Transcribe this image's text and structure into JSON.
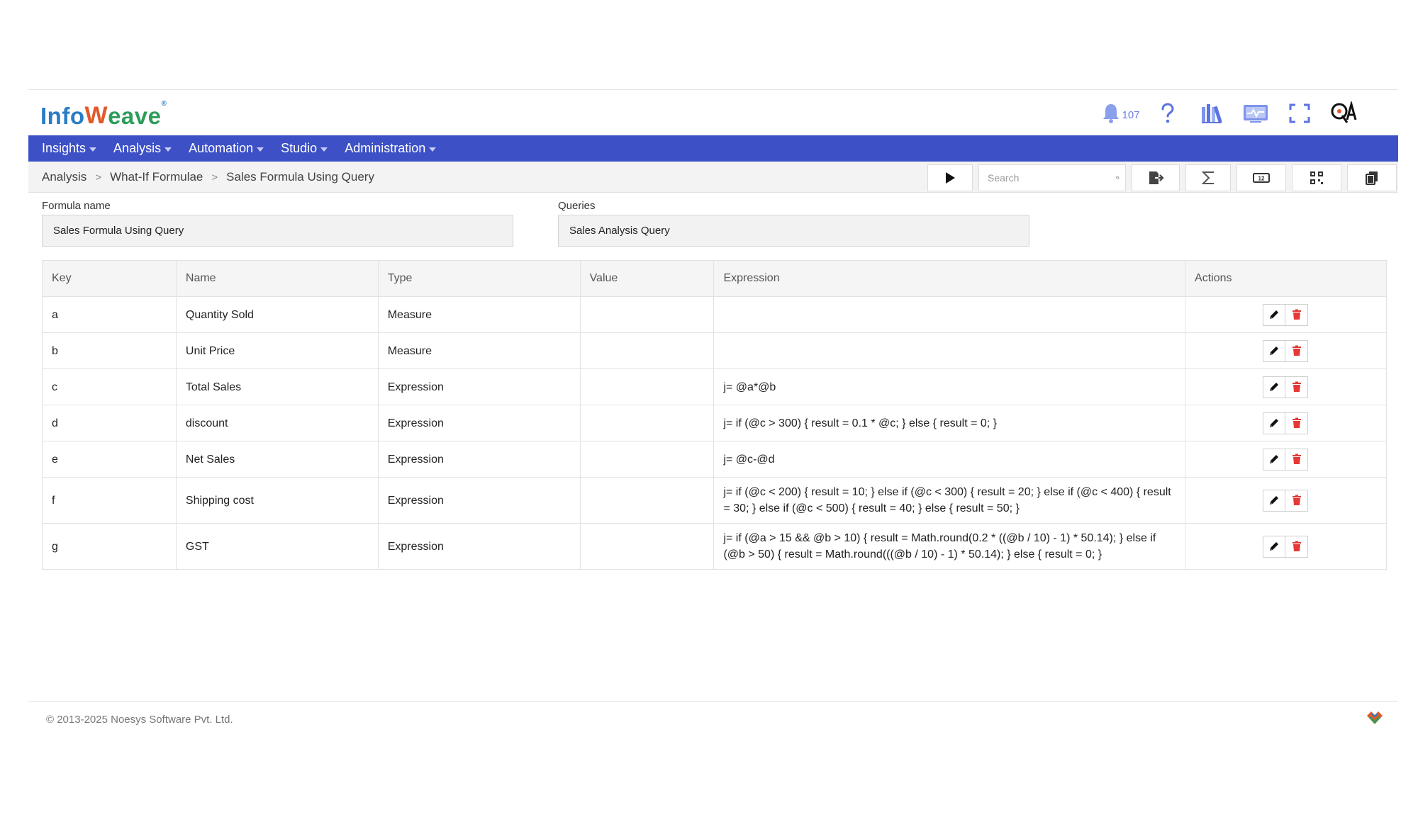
{
  "brand": {
    "logo_text_1": "Info",
    "logo_text_2": "W",
    "logo_text_3": "eave",
    "logo_reg": "®",
    "colors": {
      "blue": "#2b7cc4",
      "orange": "#e05a2b",
      "green": "#2f9c5b"
    }
  },
  "header": {
    "notifications_count": "107",
    "icons": [
      "bell-icon",
      "help-icon",
      "library-icon",
      "monitor-icon",
      "fullscreen-icon",
      "qa-search-icon"
    ]
  },
  "nav": {
    "bg_color": "#3d50c6",
    "items": [
      {
        "label": "Insights"
      },
      {
        "label": "Analysis"
      },
      {
        "label": "Automation"
      },
      {
        "label": "Studio"
      },
      {
        "label": "Administration"
      }
    ]
  },
  "breadcrumb": {
    "items": [
      "Analysis",
      "What-If Formulae",
      "Sales Formula Using Query"
    ],
    "separator": ">"
  },
  "toolbar": {
    "search_placeholder": "Search",
    "icons": [
      "run-icon",
      "search-icon",
      "export-icon",
      "sigma-icon",
      "number-icon",
      "qr-icon",
      "copy-icon"
    ]
  },
  "form": {
    "formula_name_label": "Formula name",
    "formula_name_value": "Sales Formula Using Query",
    "queries_label": "Queries",
    "queries_value": "Sales Analysis Query"
  },
  "table": {
    "headers": [
      "Key",
      "Name",
      "Type",
      "Value",
      "Expression",
      "Actions"
    ],
    "rows": [
      {
        "key": "a",
        "name": "Quantity Sold",
        "type": "Measure",
        "value": "",
        "expression": ""
      },
      {
        "key": "b",
        "name": "Unit Price",
        "type": "Measure",
        "value": "",
        "expression": ""
      },
      {
        "key": "c",
        "name": "Total Sales",
        "type": "Expression",
        "value": "",
        "expression": "j= @a*@b"
      },
      {
        "key": "d",
        "name": "discount",
        "type": "Expression",
        "value": "",
        "expression": "j= if (@c > 300) { result = 0.1 * @c; } else { result = 0; }"
      },
      {
        "key": "e",
        "name": "Net Sales",
        "type": "Expression",
        "value": "",
        "expression": "j= @c-@d"
      },
      {
        "key": "f",
        "name": "Shipping cost",
        "type": "Expression",
        "value": "",
        "expression": "j= if (@c < 200) { result = 10; } else if (@c < 300) { result = 20; } else if (@c < 400) { result = 30; } else if (@c < 500) { result = 40; } else { result = 50; }"
      },
      {
        "key": "g",
        "name": "GST",
        "type": "Expression",
        "value": "",
        "expression": "j= if (@a > 15 && @b > 10) { result = Math.round(0.2 * ((@b / 10) - 1) * 50.14); } else if (@b > 50) { result = Math.round(((@b / 10) - 1) * 50.14); } else { result = 0; }"
      }
    ],
    "row_action_icons": [
      "edit-pencil-icon",
      "delete-trash-icon"
    ],
    "delete_color": "#e53935"
  },
  "footer": {
    "copyright": "© 2013-2025 Noesys Software Pvt. Ltd."
  }
}
